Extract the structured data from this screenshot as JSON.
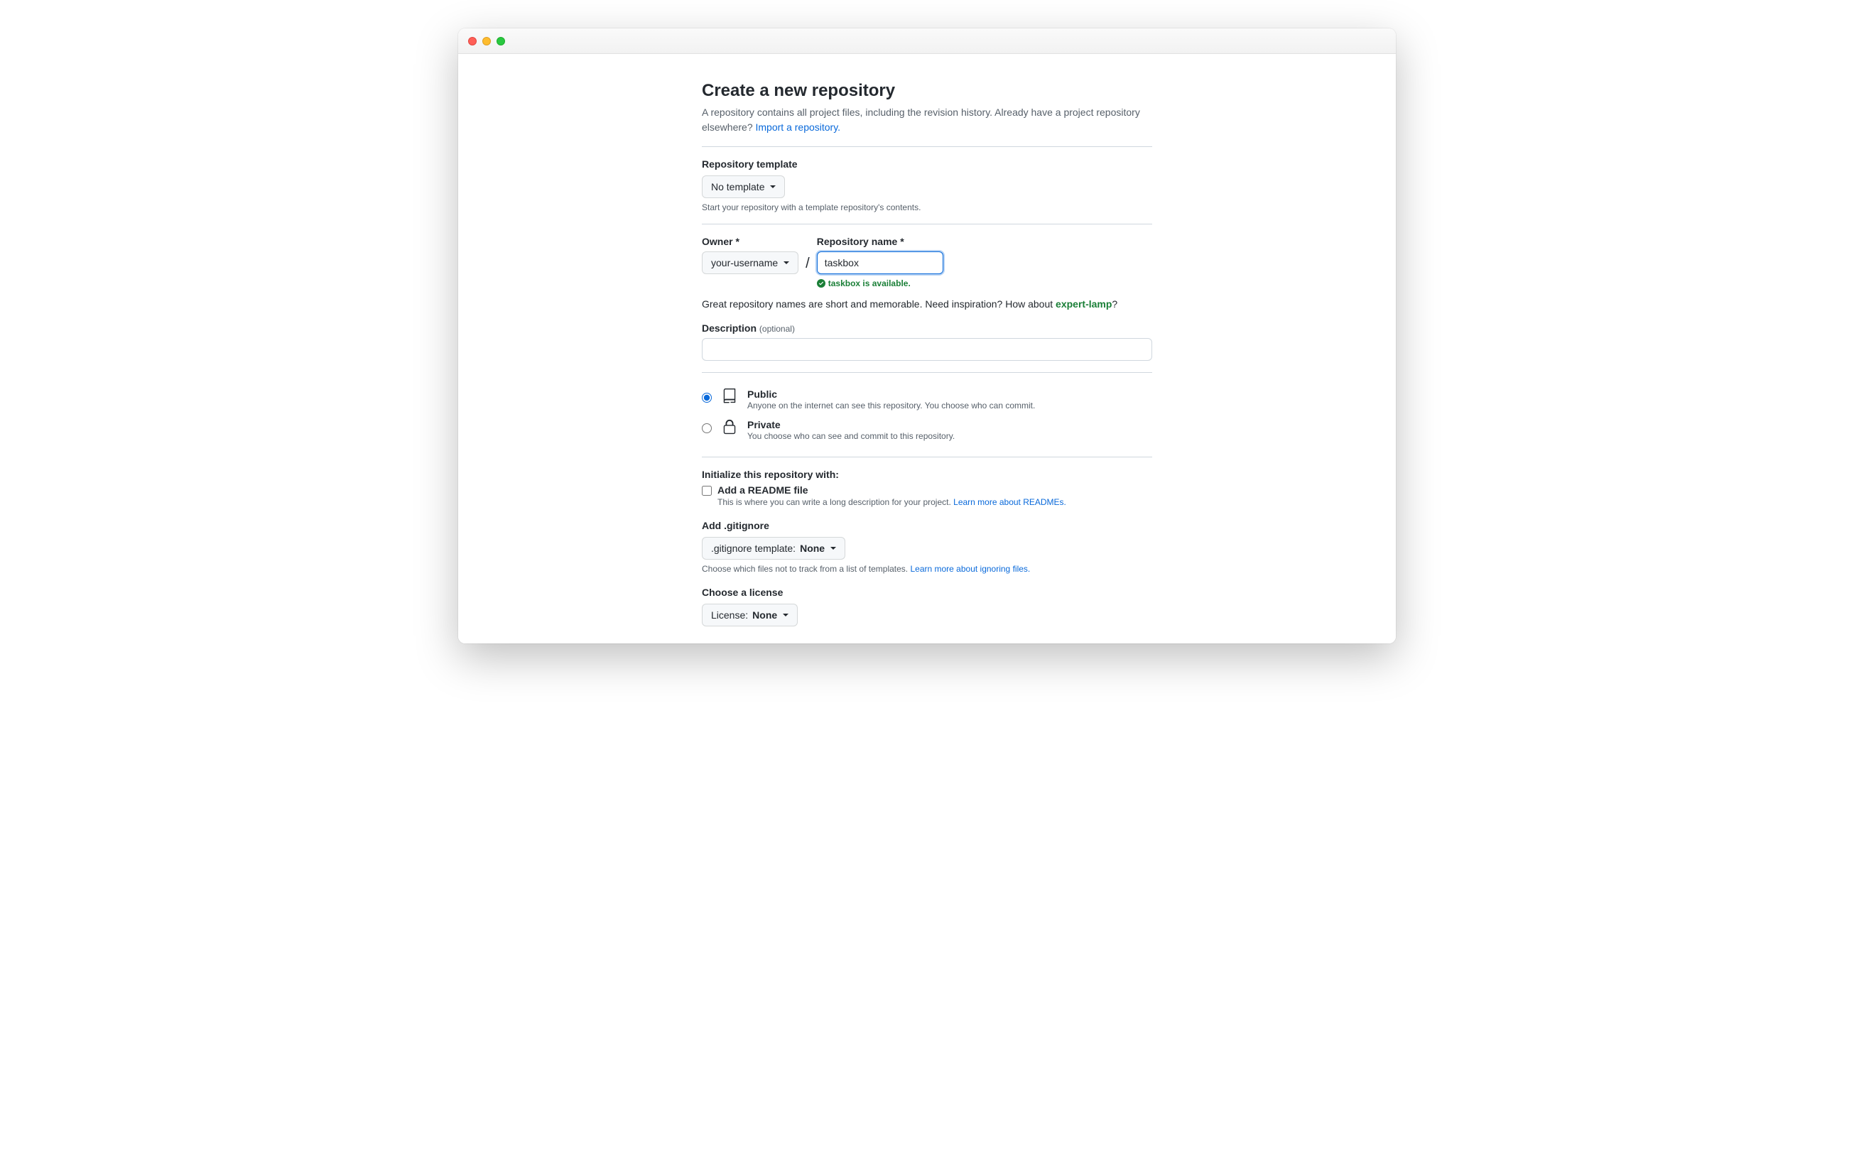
{
  "page": {
    "title": "Create a new repository",
    "subtitle_prefix": "A repository contains all project files, including the revision history. Already have a project repository elsewhere? ",
    "import_link": "Import a repository."
  },
  "template": {
    "label": "Repository template",
    "selected": "No template",
    "hint": "Start your repository with a template repository's contents."
  },
  "owner": {
    "label": "Owner *",
    "selected": "your-username"
  },
  "repo_name": {
    "label": "Repository name *",
    "value": "taskbox",
    "availability": "taskbox is available."
  },
  "inspiration": {
    "prefix": "Great repository names are short and memorable. Need inspiration? How about ",
    "suggestion": "expert-lamp",
    "suffix": "?"
  },
  "description": {
    "label": "Description",
    "optional": "(optional)",
    "value": ""
  },
  "visibility": {
    "public": {
      "title": "Public",
      "desc": "Anyone on the internet can see this repository. You choose who can commit."
    },
    "private": {
      "title": "Private",
      "desc": "You choose who can see and commit to this repository."
    },
    "selected": "public"
  },
  "initialize": {
    "heading": "Initialize this repository with:",
    "readme": {
      "title": "Add a README file",
      "desc_prefix": "This is where you can write a long description for your project. ",
      "link": "Learn more about READMEs."
    }
  },
  "gitignore": {
    "heading": "Add .gitignore",
    "button_prefix": ".gitignore template: ",
    "selected": "None",
    "hint_prefix": "Choose which files not to track from a list of templates. ",
    "link": "Learn more about ignoring files."
  },
  "license": {
    "heading": "Choose a license",
    "button_prefix": "License: ",
    "selected": "None"
  }
}
